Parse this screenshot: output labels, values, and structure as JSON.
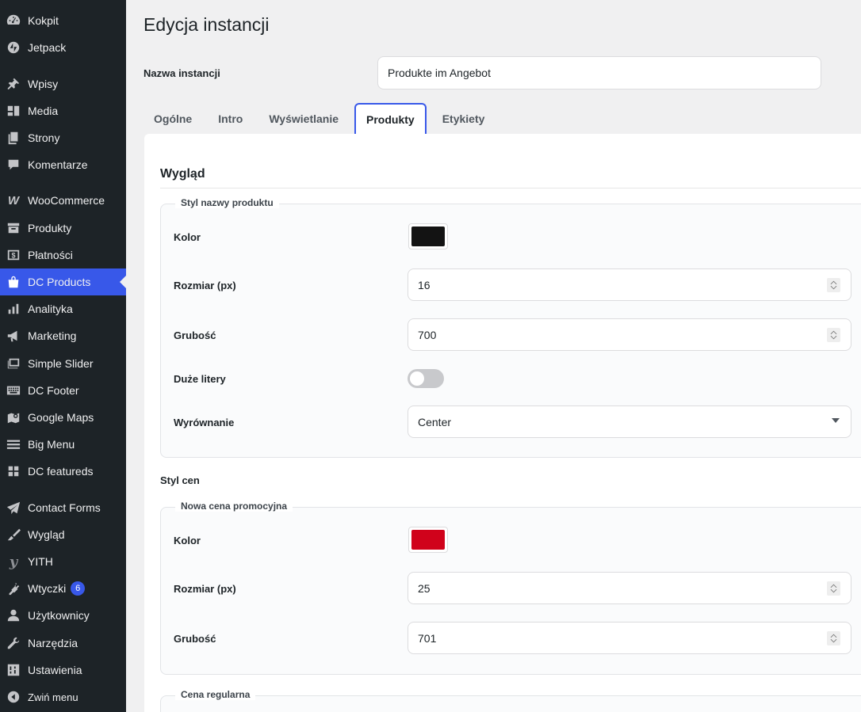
{
  "sidebar": {
    "items": [
      {
        "label": "Kokpit",
        "icon": "dashboard-icon"
      },
      {
        "label": "Jetpack",
        "icon": "jetpack-icon"
      },
      {
        "label": "Wpisy",
        "icon": "pin-icon"
      },
      {
        "label": "Media",
        "icon": "media-icon"
      },
      {
        "label": "Strony",
        "icon": "pages-icon"
      },
      {
        "label": "Komentarze",
        "icon": "comment-icon"
      },
      {
        "label": "WooCommerce",
        "icon": "woocommerce-icon"
      },
      {
        "label": "Produkty",
        "icon": "archive-icon"
      },
      {
        "label": "Płatności",
        "icon": "payments-icon"
      },
      {
        "label": "DC Products",
        "icon": "bag-icon"
      },
      {
        "label": "Analityka",
        "icon": "bar-chart-icon"
      },
      {
        "label": "Marketing",
        "icon": "megaphone-icon"
      },
      {
        "label": "Simple Slider",
        "icon": "slides-icon"
      },
      {
        "label": "DC Footer",
        "icon": "keyboard-icon"
      },
      {
        "label": "Google Maps",
        "icon": "map-icon"
      },
      {
        "label": "Big Menu",
        "icon": "menu-icon"
      },
      {
        "label": "DC featureds",
        "icon": "grid-icon"
      },
      {
        "label": "Contact Forms",
        "icon": "mail-icon"
      },
      {
        "label": "Wygląd",
        "icon": "brush-icon"
      },
      {
        "label": "YITH",
        "icon": "yith-icon"
      },
      {
        "label": "Wtyczki",
        "icon": "plugin-icon",
        "badge": "6"
      },
      {
        "label": "Użytkownicy",
        "icon": "user-icon"
      },
      {
        "label": "Narzędzia",
        "icon": "wrench-icon"
      },
      {
        "label": "Ustawienia",
        "icon": "settings-icon"
      }
    ],
    "collapse_label": "Zwiń menu",
    "active_color": "#3858e9"
  },
  "page": {
    "title": "Edycja instancji",
    "name_label": "Nazwa instancji",
    "name_value": "Produkte im Angebot"
  },
  "tabs": [
    "Ogólne",
    "Intro",
    "Wyświetlanie",
    "Produkty",
    "Etykiety"
  ],
  "active_tab": "Produkty",
  "panel": {
    "section_title": "Wygląd",
    "name_style": {
      "legend": "Styl nazwy produktu",
      "color_label": "Kolor",
      "color_value": "#131313",
      "size_label": "Rozmiar (px)",
      "size_value": "16",
      "weight_label": "Grubość",
      "weight_value": "700",
      "uppercase_label": "Duże litery",
      "uppercase_on": false,
      "align_label": "Wyrównanie",
      "align_value": "Center"
    },
    "price_style_heading": "Styl cen",
    "promo_price": {
      "legend": "Nowa cena promocyjna",
      "color_label": "Kolor",
      "color_value": "#d0021b",
      "size_label": "Rozmiar (px)",
      "size_value": "25",
      "weight_label": "Grubość",
      "weight_value": "701"
    },
    "regular_price": {
      "legend": "Cena regularna"
    }
  }
}
